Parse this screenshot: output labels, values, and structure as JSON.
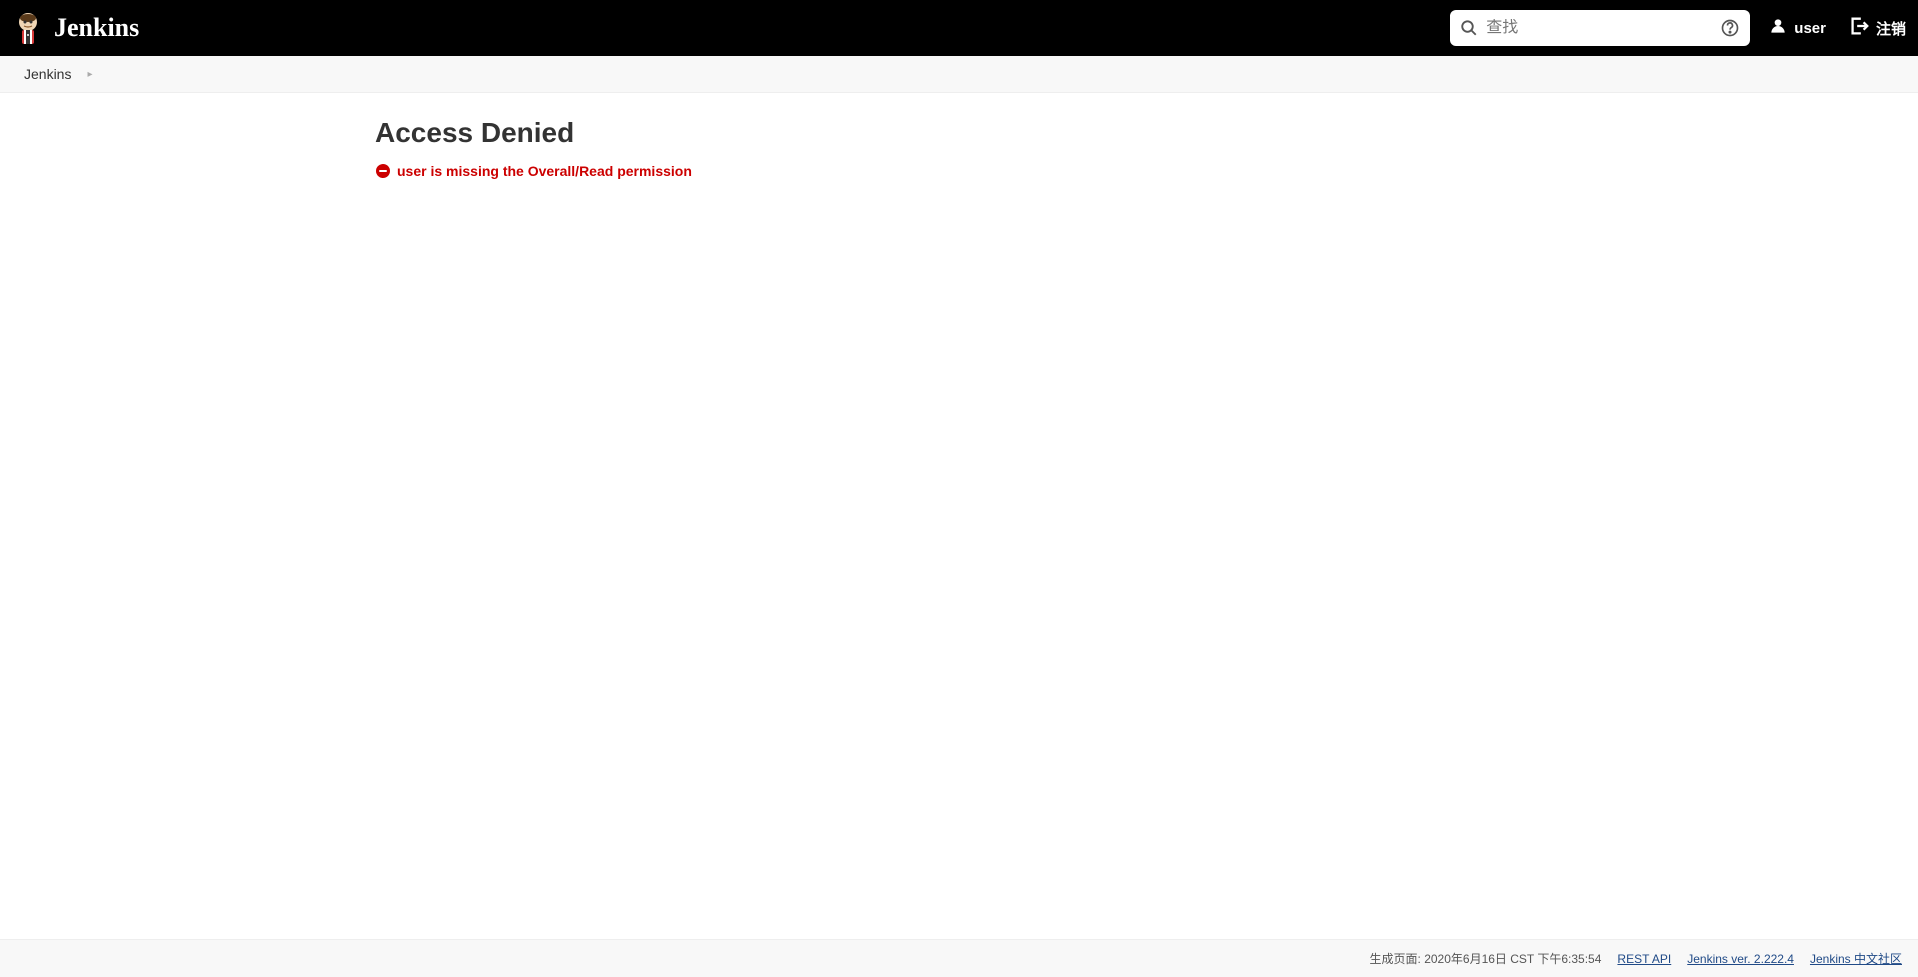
{
  "header": {
    "logo_text": "Jenkins",
    "search_placeholder": "查找",
    "user_label": "user",
    "logout_label": "注销"
  },
  "breadcrumb": {
    "items": [
      {
        "label": "Jenkins"
      }
    ]
  },
  "main": {
    "title": "Access Denied",
    "error_message": "user is missing the Overall/Read permission"
  },
  "footer": {
    "generation_label": "生成页面:",
    "generation_time": "2020年6月16日 CST 下午6:35:54",
    "rest_api": "REST API",
    "version": "Jenkins ver. 2.222.4",
    "community": "Jenkins 中文社区"
  }
}
